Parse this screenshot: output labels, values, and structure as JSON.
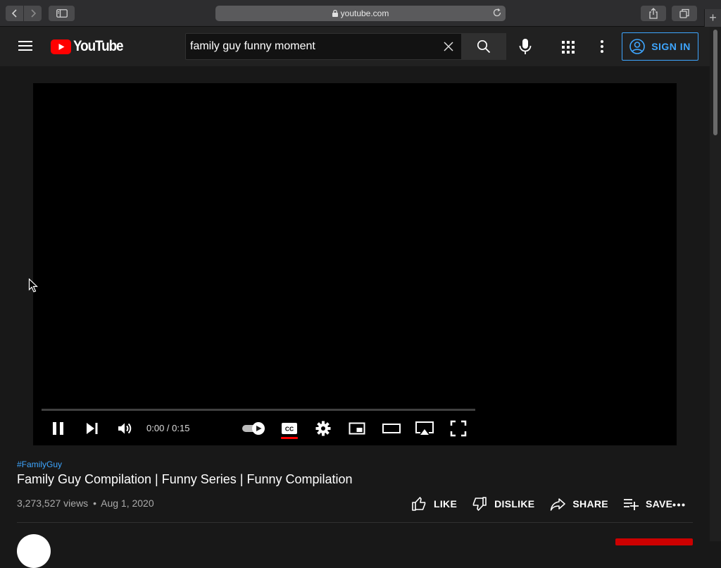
{
  "browser": {
    "url": "youtube.com",
    "newtab_label": "+"
  },
  "header": {
    "logo_text": "YouTube",
    "search_value": "family guy funny moment",
    "signin_label": "SIGN IN",
    "accent_color": "#3ea6ff",
    "brand_color": "#ff0000"
  },
  "player": {
    "time": "0:00 / 0:15",
    "progress": 0,
    "autoplay": true
  },
  "video": {
    "hashtag": "#FamilyGuy",
    "title": "Family Guy Compilation | Funny Series | Funny Compilation",
    "views": "3,273,527 views",
    "separator": "•",
    "date": "Aug 1, 2020"
  },
  "actions": {
    "like": "LIKE",
    "dislike": "DISLIKE",
    "share": "SHARE",
    "save": "SAVE"
  }
}
